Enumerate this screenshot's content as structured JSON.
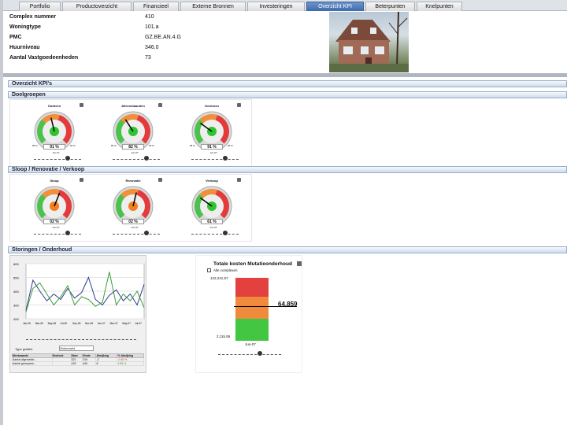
{
  "tabs": [
    "Portfolio",
    "Productoverzicht",
    "Financieel",
    "Externe Bronnen",
    "Investeringen",
    "Overzicht KPI",
    "Beterpunten",
    "Knelpunten"
  ],
  "active_tab": "Overzicht KPI",
  "info": [
    {
      "label": "Complex nummer",
      "value": "410"
    },
    {
      "label": "Woningtype",
      "value": "101.a"
    },
    {
      "label": "PMC",
      "value": "GZ.BE.AN.4.G"
    },
    {
      "label": "Huurniveau",
      "value": "346.0"
    },
    {
      "label": "Aantal Vastgoedeenheden",
      "value": "73"
    }
  ],
  "kpi_header": "Overzicht KPI's",
  "sections": {
    "doelgroepen": {
      "title": "Doelgroepen",
      "gauges": [
        {
          "title": "Ouderen",
          "value": "91 %",
          "min": "86 %",
          "max": "96 %",
          "date": "Jun-07",
          "level": 0.45
        },
        {
          "title": "Alleenstaanden",
          "value": "82 %",
          "min": "80 %",
          "max": "90 %",
          "date": "Jun-07",
          "level": 0.38
        },
        {
          "title": "Gezinnen",
          "value": "91 %",
          "min": "86 %",
          "max": "96 %",
          "date": "Jun-07",
          "level": 0.3
        }
      ]
    },
    "sloop": {
      "title": "Sloop / Renovatie / Verkoop",
      "gauges": [
        {
          "title": "Sloop",
          "value": "02 %",
          "min": "",
          "max": "",
          "date": "Jun-07",
          "level": 0.58
        },
        {
          "title": "Renovatie",
          "value": "02 %",
          "min": "",
          "max": "",
          "date": "Jun-07",
          "level": 0.55
        },
        {
          "title": "Verkoop",
          "value": "61 %",
          "min": "",
          "max": "",
          "date": "Jun-07",
          "level": 0.3
        }
      ]
    },
    "storingen": {
      "title": "Storingen / Onderhoud"
    }
  },
  "line_chart": {
    "yticks": [
      "600",
      "500",
      "400",
      "300",
      "200"
    ],
    "xticks": [
      "Jan-06",
      "Mar-06",
      "May-06",
      "Jul-06",
      "Sep-06",
      "Nov-06",
      "Jan-07",
      "Mar-07",
      "May-07",
      "Jul-07"
    ],
    "series": [
      {
        "color": "#2e3a8c",
        "values": [
          260,
          480,
          400,
          330,
          380,
          340,
          420,
          350,
          390,
          500,
          340,
          300,
          370,
          410,
          330,
          380,
          300,
          450
        ]
      },
      {
        "color": "#3a9d3a",
        "values": [
          250,
          420,
          460,
          380,
          300,
          360,
          440,
          300,
          360,
          340,
          290,
          320,
          540,
          300,
          380,
          330,
          400,
          280
        ]
      }
    ],
    "dropdown_label": "Type grafiek:",
    "dropdown_value": "Onbevoeld",
    "table_headers": [
      "Meetwaarde",
      "Eenheid",
      "Start",
      "Einde",
      "Afwijking",
      "% Afwijking"
    ],
    "table_rows": [
      {
        "name": "Aantal afgemelde...",
        "unit": "",
        "start": "321",
        "end": "319",
        "delta": "-2",
        "pct": "-0.62 %"
      },
      {
        "name": "Aantal gereparee...",
        "unit": "",
        "start": "432",
        "end": "440",
        "delta": "8",
        "pct": "1.85 %"
      }
    ]
  },
  "mutatie": {
    "title": "Totale kosten Mutatieonderhoud",
    "checkbox_label": "Alle complexen",
    "top": "122,241.67",
    "bottom": "2,115.06",
    "marker": "64,859",
    "date": "Jun-07"
  }
}
